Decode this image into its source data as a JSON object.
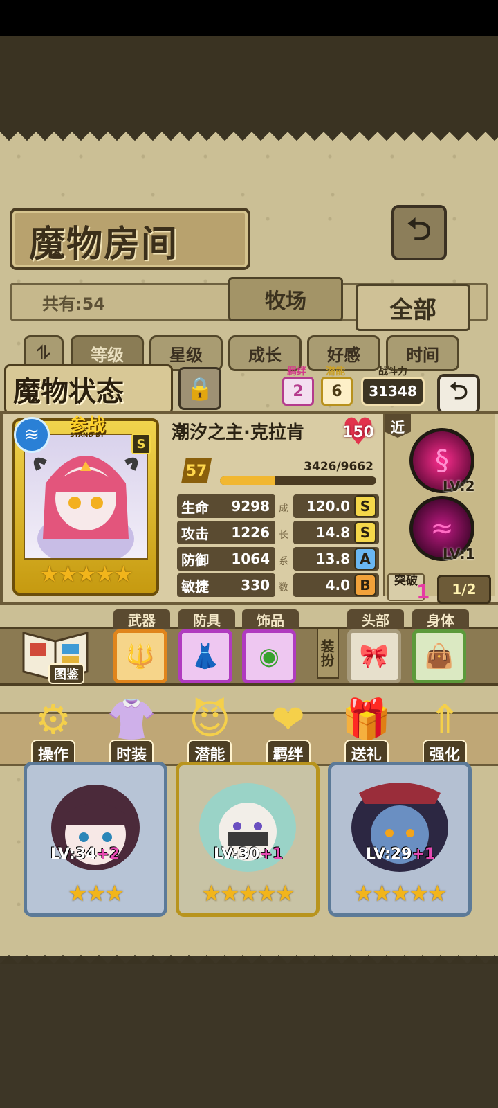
{
  "header": {
    "title": "魔物房间",
    "back_icon": "return-arrow-icon"
  },
  "filter": {
    "count_label": "共有:54",
    "tab_ranch": "牧场",
    "tab_all": "全部"
  },
  "sort": {
    "toggle_icon": "sort-toggle-icon",
    "buttons": [
      "等级",
      "星级",
      "成长",
      "好感",
      "时间"
    ]
  },
  "status": {
    "title": "魔物状态",
    "bond_label": "羁绊",
    "bond_value": "2",
    "potential_label": "潜能",
    "potential_value": "6",
    "power_label": "战斗力",
    "power_value": "31348",
    "monster_name": "潮汐之主·克拉肯",
    "affection": "150",
    "level": "57",
    "exp_text": "3426/9662",
    "exp_fraction": 0.3546,
    "badge_top": "参战",
    "badge_sub": "STAND BY",
    "rank_grade": "S",
    "star_count": 5,
    "stats": [
      {
        "name": "生命",
        "value": "9298",
        "growth": "120.0",
        "grade": "S"
      },
      {
        "name": "攻击",
        "value": "1226",
        "growth": "14.8",
        "grade": "S"
      },
      {
        "name": "防御",
        "value": "1064",
        "growth": "13.8",
        "grade": "A"
      },
      {
        "name": "敏捷",
        "value": "330",
        "growth": "4.0",
        "grade": "B"
      }
    ],
    "growth_vertical": [
      "成",
      "长",
      "系",
      "数"
    ],
    "range_label": "近",
    "skills": [
      {
        "level": "LV:2",
        "icon": "tentacle-skill-icon"
      },
      {
        "level": "LV:1",
        "icon": "wave-skill-icon"
      }
    ],
    "breakthrough_label": "突破",
    "breakthrough_value": "1",
    "breakthrough_progress": "1/2"
  },
  "equipment": {
    "book_label": "图鉴",
    "slots": [
      {
        "label": "武器",
        "icon": "trident-icon"
      },
      {
        "label": "防具",
        "icon": "maid-dress-icon"
      },
      {
        "label": "饰品",
        "icon": "eye-amulet-icon"
      }
    ],
    "costume_label": "装扮",
    "costume_slots": [
      {
        "label": "头部",
        "icon": "horn-headband-icon"
      },
      {
        "label": "身体",
        "icon": "handbag-icon"
      }
    ]
  },
  "actions": [
    {
      "label": "操作",
      "icon": "gear-icon"
    },
    {
      "label": "时装",
      "icon": "outfit-icon"
    },
    {
      "label": "潜能",
      "icon": "devil-silhouette-icon"
    },
    {
      "label": "羁绊",
      "icon": "hearts-icon"
    },
    {
      "label": "送礼",
      "icon": "gift-icon"
    },
    {
      "label": "强化",
      "icon": "upgrade-arrows-icon"
    }
  ],
  "cards": [
    {
      "level": "LV:34",
      "bonus": "+2",
      "stars": 3
    },
    {
      "level": "LV:30",
      "bonus": "+1",
      "stars": 5
    },
    {
      "level": "LV:29",
      "bonus": "+1",
      "stars": 5
    }
  ],
  "colors": {
    "accent_gold": "#f2b51b",
    "exp_bar": "#f1b730",
    "grade_s": "#f5d84a",
    "grade_a": "#6ab7f2",
    "grade_b": "#f2a23a"
  }
}
